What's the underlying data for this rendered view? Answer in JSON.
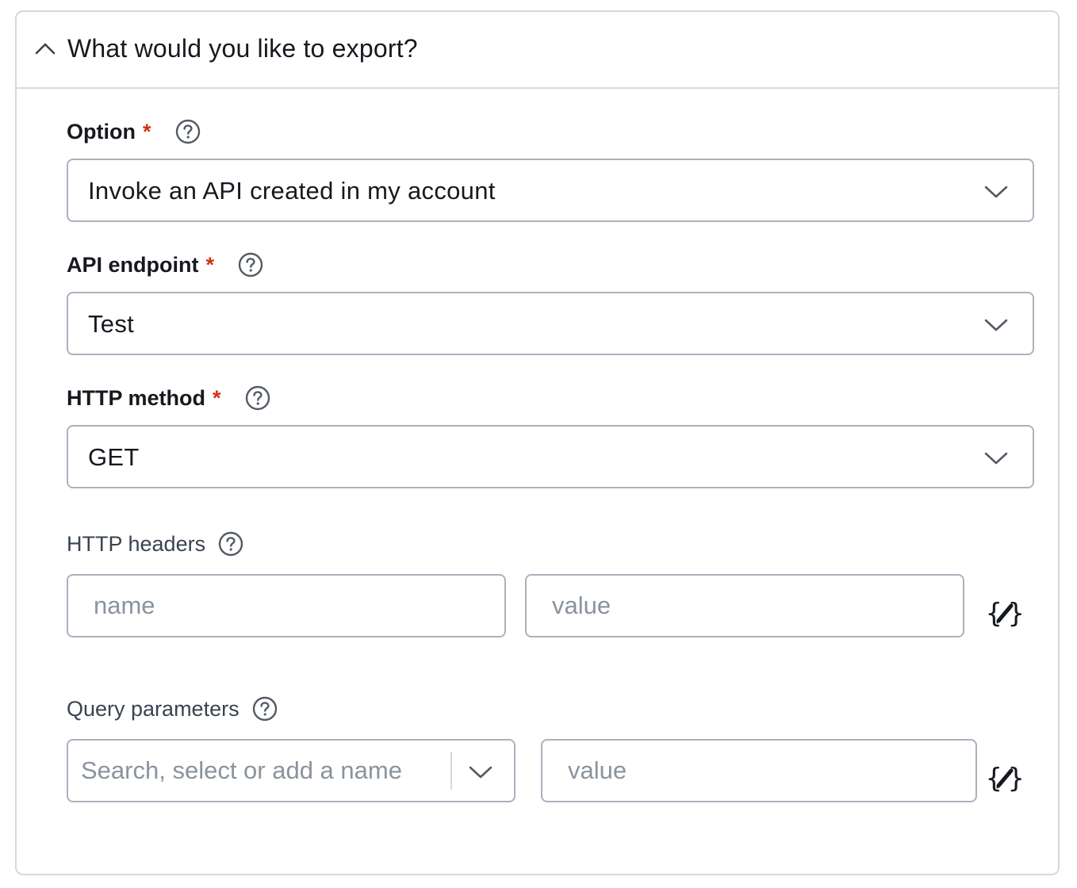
{
  "panel": {
    "title": "What would you like to export?",
    "collapse_icon": "chevron-up-icon"
  },
  "fields": {
    "option": {
      "label": "Option",
      "required_mark": "*",
      "value": "Invoke an API created in my account"
    },
    "api_endpoint": {
      "label": "API endpoint",
      "required_mark": "*",
      "value": "Test"
    },
    "http_method": {
      "label": "HTTP method",
      "required_mark": "*",
      "value": "GET"
    },
    "http_headers": {
      "label": "HTTP headers",
      "name_placeholder": "name",
      "value_placeholder": "value"
    },
    "query_parameters": {
      "label": "Query parameters",
      "name_placeholder": "Search, select or add a name",
      "value_placeholder": "value"
    }
  },
  "icons": {
    "help": "help-circle-icon",
    "dropdown": "chevron-down-icon",
    "dynamic_value": "curly-braces-pencil-icon"
  },
  "colors": {
    "required": "#d13212",
    "border": "#aab2bd",
    "divider": "#d5d9dd",
    "placeholder": "#8a939e"
  }
}
